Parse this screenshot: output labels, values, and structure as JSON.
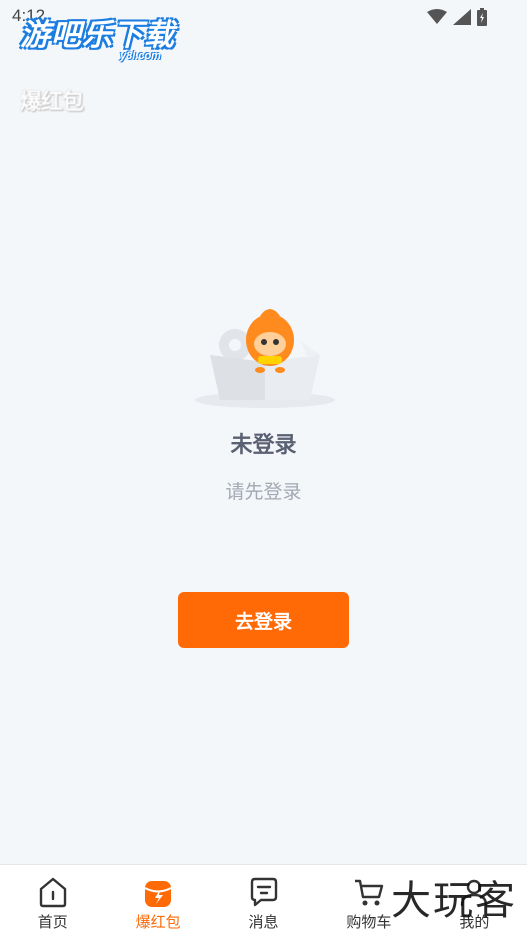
{
  "status_bar": {
    "time": "4:12"
  },
  "watermark": {
    "brand": "游吧乐下载",
    "domain": "y8l.com",
    "corner": "大玩客"
  },
  "header": {
    "title": "爆红包"
  },
  "empty_state": {
    "title": "未登录",
    "subtitle": "请先登录"
  },
  "action": {
    "login_label": "去登录"
  },
  "tab_bar": {
    "items": [
      {
        "label": "首页",
        "icon": "home-icon"
      },
      {
        "label": "爆红包",
        "icon": "red-packet-icon",
        "active": true
      },
      {
        "label": "消息",
        "icon": "message-icon"
      },
      {
        "label": "购物车",
        "icon": "cart-icon"
      },
      {
        "label": "我的",
        "icon": "profile-icon"
      }
    ]
  },
  "colors": {
    "accent": "#ff6a07",
    "background": "#f4f7fa",
    "watermark_blue": "#1d7ee0"
  }
}
